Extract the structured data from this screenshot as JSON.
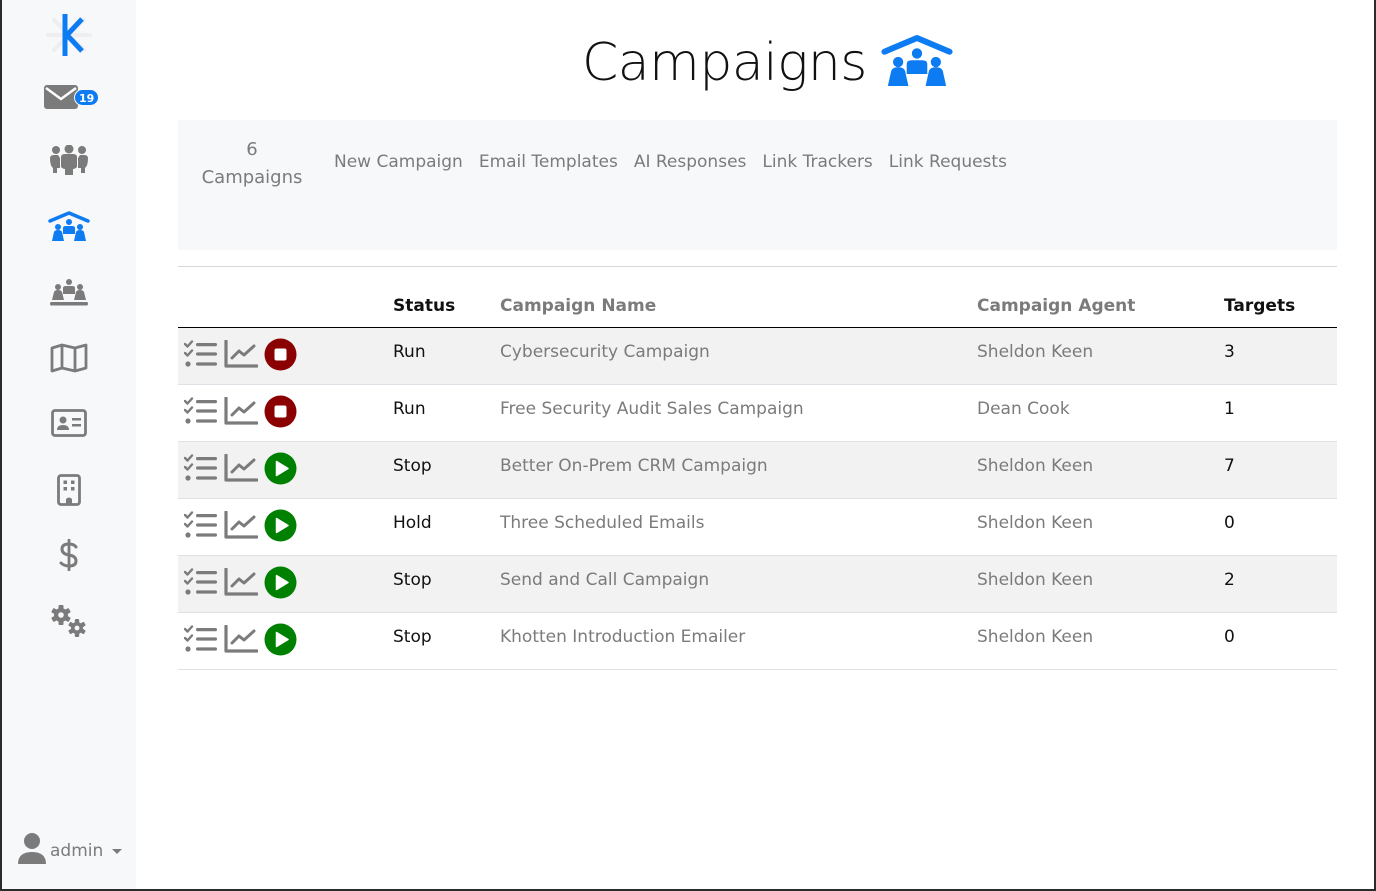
{
  "sidebar": {
    "logo": "k-logo-icon",
    "items": [
      {
        "name": "inbox",
        "icon": "envelope-icon",
        "badge": "19",
        "active": false
      },
      {
        "name": "contacts",
        "icon": "users-icon",
        "active": false
      },
      {
        "name": "campaigns",
        "icon": "people-roof-icon",
        "active": true
      },
      {
        "name": "groups",
        "icon": "people-line-icon",
        "active": false
      },
      {
        "name": "map",
        "icon": "map-icon",
        "active": false
      },
      {
        "name": "id-cards",
        "icon": "address-card-icon",
        "active": false
      },
      {
        "name": "companies",
        "icon": "building-icon",
        "active": false
      },
      {
        "name": "billing",
        "icon": "dollar-icon",
        "active": false
      },
      {
        "name": "settings",
        "icon": "gears-icon",
        "active": false
      }
    ],
    "user": {
      "name": "admin",
      "icon": "user-icon"
    }
  },
  "header": {
    "title": "Campaigns",
    "icon": "people-roof-icon"
  },
  "subnav": {
    "count_number": "6",
    "count_label": "Campaigns",
    "links": [
      "New Campaign",
      "Email Templates",
      "AI Responses",
      "Link Trackers",
      "Link Requests"
    ]
  },
  "table": {
    "columns": [
      "",
      "Status",
      "Campaign Name",
      "Campaign Agent",
      "Targets"
    ],
    "rows": [
      {
        "status": "Run",
        "name": "Cybersecurity Campaign",
        "agent": "Sheldon Keen",
        "targets": "3",
        "toggle": "stop"
      },
      {
        "status": "Run",
        "name": "Free Security Audit Sales Campaign",
        "agent": "Dean Cook",
        "targets": "1",
        "toggle": "stop"
      },
      {
        "status": "Stop",
        "name": "Better On-Prem CRM Campaign",
        "agent": "Sheldon Keen",
        "targets": "7",
        "toggle": "play"
      },
      {
        "status": "Hold",
        "name": "Three Scheduled Emails",
        "agent": "Sheldon Keen",
        "targets": "0",
        "toggle": "play"
      },
      {
        "status": "Stop",
        "name": "Send and Call Campaign",
        "agent": "Sheldon Keen",
        "targets": "2",
        "toggle": "play"
      },
      {
        "status": "Stop",
        "name": "Khotten Introduction Emailer",
        "agent": "Sheldon Keen",
        "targets": "0",
        "toggle": "play"
      }
    ]
  },
  "colors": {
    "accent": "#0d7bf2",
    "icon_gray": "#7b7b7b",
    "stop_red": "#8b0000",
    "play_green": "#008000"
  }
}
